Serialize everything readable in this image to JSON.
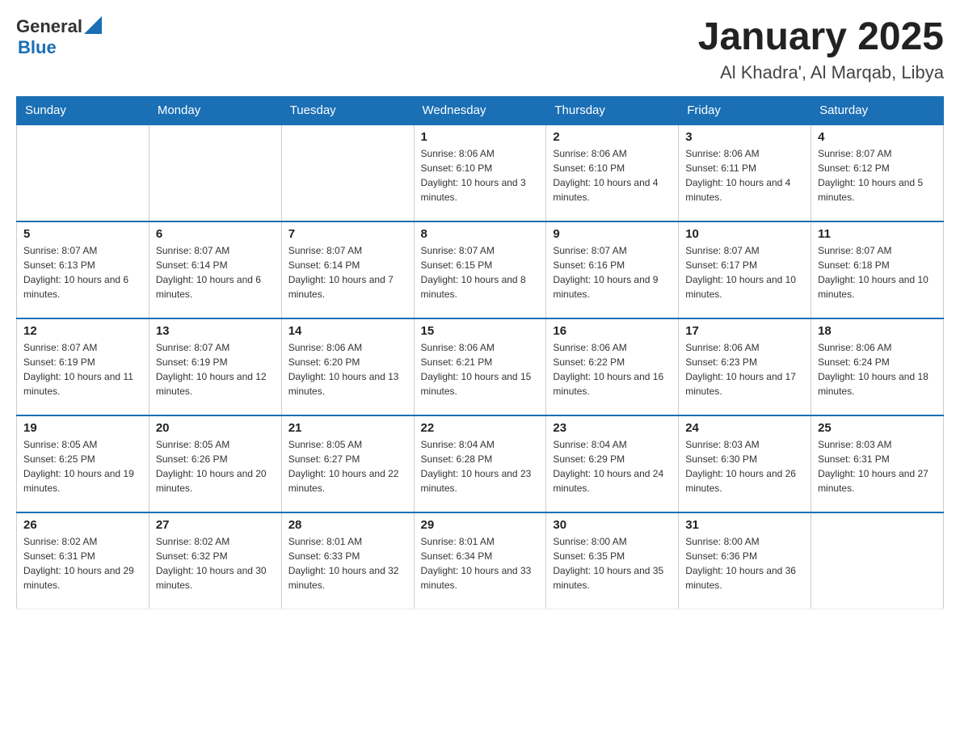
{
  "header": {
    "logo_general": "General",
    "logo_blue": "Blue",
    "month_title": "January 2025",
    "location": "Al Khadra', Al Marqab, Libya"
  },
  "weekdays": [
    "Sunday",
    "Monday",
    "Tuesday",
    "Wednesday",
    "Thursday",
    "Friday",
    "Saturday"
  ],
  "weeks": [
    [
      {
        "day": "",
        "info": ""
      },
      {
        "day": "",
        "info": ""
      },
      {
        "day": "",
        "info": ""
      },
      {
        "day": "1",
        "info": "Sunrise: 8:06 AM\nSunset: 6:10 PM\nDaylight: 10 hours and 3 minutes."
      },
      {
        "day": "2",
        "info": "Sunrise: 8:06 AM\nSunset: 6:10 PM\nDaylight: 10 hours and 4 minutes."
      },
      {
        "day": "3",
        "info": "Sunrise: 8:06 AM\nSunset: 6:11 PM\nDaylight: 10 hours and 4 minutes."
      },
      {
        "day": "4",
        "info": "Sunrise: 8:07 AM\nSunset: 6:12 PM\nDaylight: 10 hours and 5 minutes."
      }
    ],
    [
      {
        "day": "5",
        "info": "Sunrise: 8:07 AM\nSunset: 6:13 PM\nDaylight: 10 hours and 6 minutes."
      },
      {
        "day": "6",
        "info": "Sunrise: 8:07 AM\nSunset: 6:14 PM\nDaylight: 10 hours and 6 minutes."
      },
      {
        "day": "7",
        "info": "Sunrise: 8:07 AM\nSunset: 6:14 PM\nDaylight: 10 hours and 7 minutes."
      },
      {
        "day": "8",
        "info": "Sunrise: 8:07 AM\nSunset: 6:15 PM\nDaylight: 10 hours and 8 minutes."
      },
      {
        "day": "9",
        "info": "Sunrise: 8:07 AM\nSunset: 6:16 PM\nDaylight: 10 hours and 9 minutes."
      },
      {
        "day": "10",
        "info": "Sunrise: 8:07 AM\nSunset: 6:17 PM\nDaylight: 10 hours and 10 minutes."
      },
      {
        "day": "11",
        "info": "Sunrise: 8:07 AM\nSunset: 6:18 PM\nDaylight: 10 hours and 10 minutes."
      }
    ],
    [
      {
        "day": "12",
        "info": "Sunrise: 8:07 AM\nSunset: 6:19 PM\nDaylight: 10 hours and 11 minutes."
      },
      {
        "day": "13",
        "info": "Sunrise: 8:07 AM\nSunset: 6:19 PM\nDaylight: 10 hours and 12 minutes."
      },
      {
        "day": "14",
        "info": "Sunrise: 8:06 AM\nSunset: 6:20 PM\nDaylight: 10 hours and 13 minutes."
      },
      {
        "day": "15",
        "info": "Sunrise: 8:06 AM\nSunset: 6:21 PM\nDaylight: 10 hours and 15 minutes."
      },
      {
        "day": "16",
        "info": "Sunrise: 8:06 AM\nSunset: 6:22 PM\nDaylight: 10 hours and 16 minutes."
      },
      {
        "day": "17",
        "info": "Sunrise: 8:06 AM\nSunset: 6:23 PM\nDaylight: 10 hours and 17 minutes."
      },
      {
        "day": "18",
        "info": "Sunrise: 8:06 AM\nSunset: 6:24 PM\nDaylight: 10 hours and 18 minutes."
      }
    ],
    [
      {
        "day": "19",
        "info": "Sunrise: 8:05 AM\nSunset: 6:25 PM\nDaylight: 10 hours and 19 minutes."
      },
      {
        "day": "20",
        "info": "Sunrise: 8:05 AM\nSunset: 6:26 PM\nDaylight: 10 hours and 20 minutes."
      },
      {
        "day": "21",
        "info": "Sunrise: 8:05 AM\nSunset: 6:27 PM\nDaylight: 10 hours and 22 minutes."
      },
      {
        "day": "22",
        "info": "Sunrise: 8:04 AM\nSunset: 6:28 PM\nDaylight: 10 hours and 23 minutes."
      },
      {
        "day": "23",
        "info": "Sunrise: 8:04 AM\nSunset: 6:29 PM\nDaylight: 10 hours and 24 minutes."
      },
      {
        "day": "24",
        "info": "Sunrise: 8:03 AM\nSunset: 6:30 PM\nDaylight: 10 hours and 26 minutes."
      },
      {
        "day": "25",
        "info": "Sunrise: 8:03 AM\nSunset: 6:31 PM\nDaylight: 10 hours and 27 minutes."
      }
    ],
    [
      {
        "day": "26",
        "info": "Sunrise: 8:02 AM\nSunset: 6:31 PM\nDaylight: 10 hours and 29 minutes."
      },
      {
        "day": "27",
        "info": "Sunrise: 8:02 AM\nSunset: 6:32 PM\nDaylight: 10 hours and 30 minutes."
      },
      {
        "day": "28",
        "info": "Sunrise: 8:01 AM\nSunset: 6:33 PM\nDaylight: 10 hours and 32 minutes."
      },
      {
        "day": "29",
        "info": "Sunrise: 8:01 AM\nSunset: 6:34 PM\nDaylight: 10 hours and 33 minutes."
      },
      {
        "day": "30",
        "info": "Sunrise: 8:00 AM\nSunset: 6:35 PM\nDaylight: 10 hours and 35 minutes."
      },
      {
        "day": "31",
        "info": "Sunrise: 8:00 AM\nSunset: 6:36 PM\nDaylight: 10 hours and 36 minutes."
      },
      {
        "day": "",
        "info": ""
      }
    ]
  ]
}
